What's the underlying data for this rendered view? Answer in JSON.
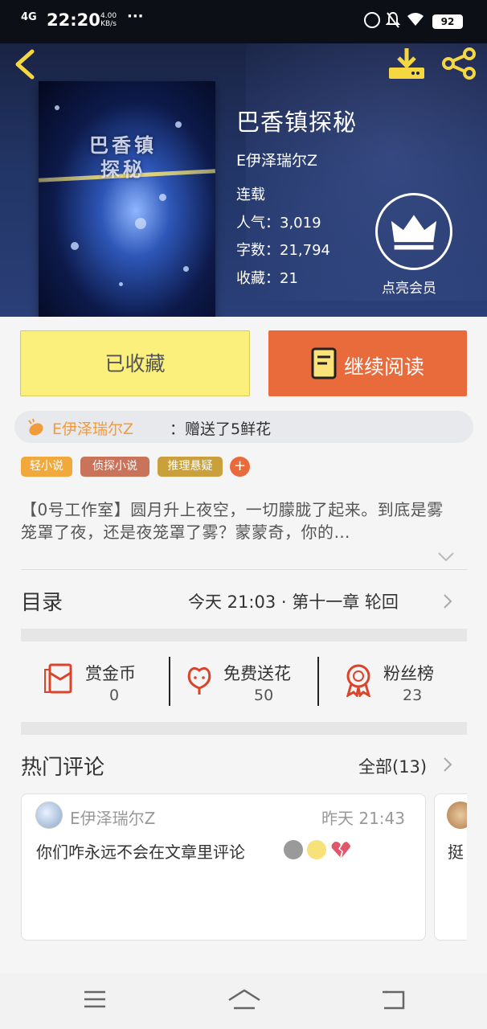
{
  "status_bar": {
    "signal": "4G",
    "time": "22:20",
    "speed_value": "4.00",
    "speed_unit": "KB/s",
    "more": "···",
    "battery": "92"
  },
  "book": {
    "cover_title": "巴香镇探秘",
    "title": "巴香镇探秘",
    "author": "E伊泽瑞尔Z",
    "status": "连载",
    "stats": [
      {
        "label": "人气：",
        "value": "3,019"
      },
      {
        "label": "字数：",
        "value": "21,794"
      },
      {
        "label": "收藏：",
        "value": "21"
      }
    ],
    "vip_label": "点亮会员"
  },
  "actions": {
    "collected_label": "已收藏",
    "read_label": "继续阅读"
  },
  "gift": {
    "user": "E伊泽瑞尔Z",
    "message": "：赠送了5鲜花"
  },
  "tags": [
    {
      "label": "轻小说",
      "color": "#f2a93b"
    },
    {
      "label": "侦探小说",
      "color": "#c9735a"
    },
    {
      "label": "推理悬疑",
      "color": "#c9a03b"
    }
  ],
  "tag_add": "+",
  "description": "【0号工作室】圆月升上夜空，一切朦胧了起来。到底是雾笼罩了夜，还是夜笼罩了雾？蒙蒙奇，你的…",
  "toc": {
    "title": "目录",
    "latest": "今天 21:03 · 第十一章 轮回"
  },
  "support": [
    {
      "label": "赏金币",
      "value": "0"
    },
    {
      "label": "免费送花",
      "value": "50"
    },
    {
      "label": "粉丝榜",
      "value": "23"
    }
  ],
  "comments": {
    "title": "热门评论",
    "all_label": "全部(13)",
    "items": [
      {
        "user": "E伊泽瑞尔Z",
        "time": "昨天 21:43",
        "text": "你们咋永远不会在文章里评论"
      },
      {
        "text": "挺"
      }
    ]
  },
  "colors": {
    "accent_orange": "#e96b3c",
    "collected_yellow": "#fbf07c",
    "icon_gold": "#f5d742",
    "icon_red": "#d9452b"
  }
}
